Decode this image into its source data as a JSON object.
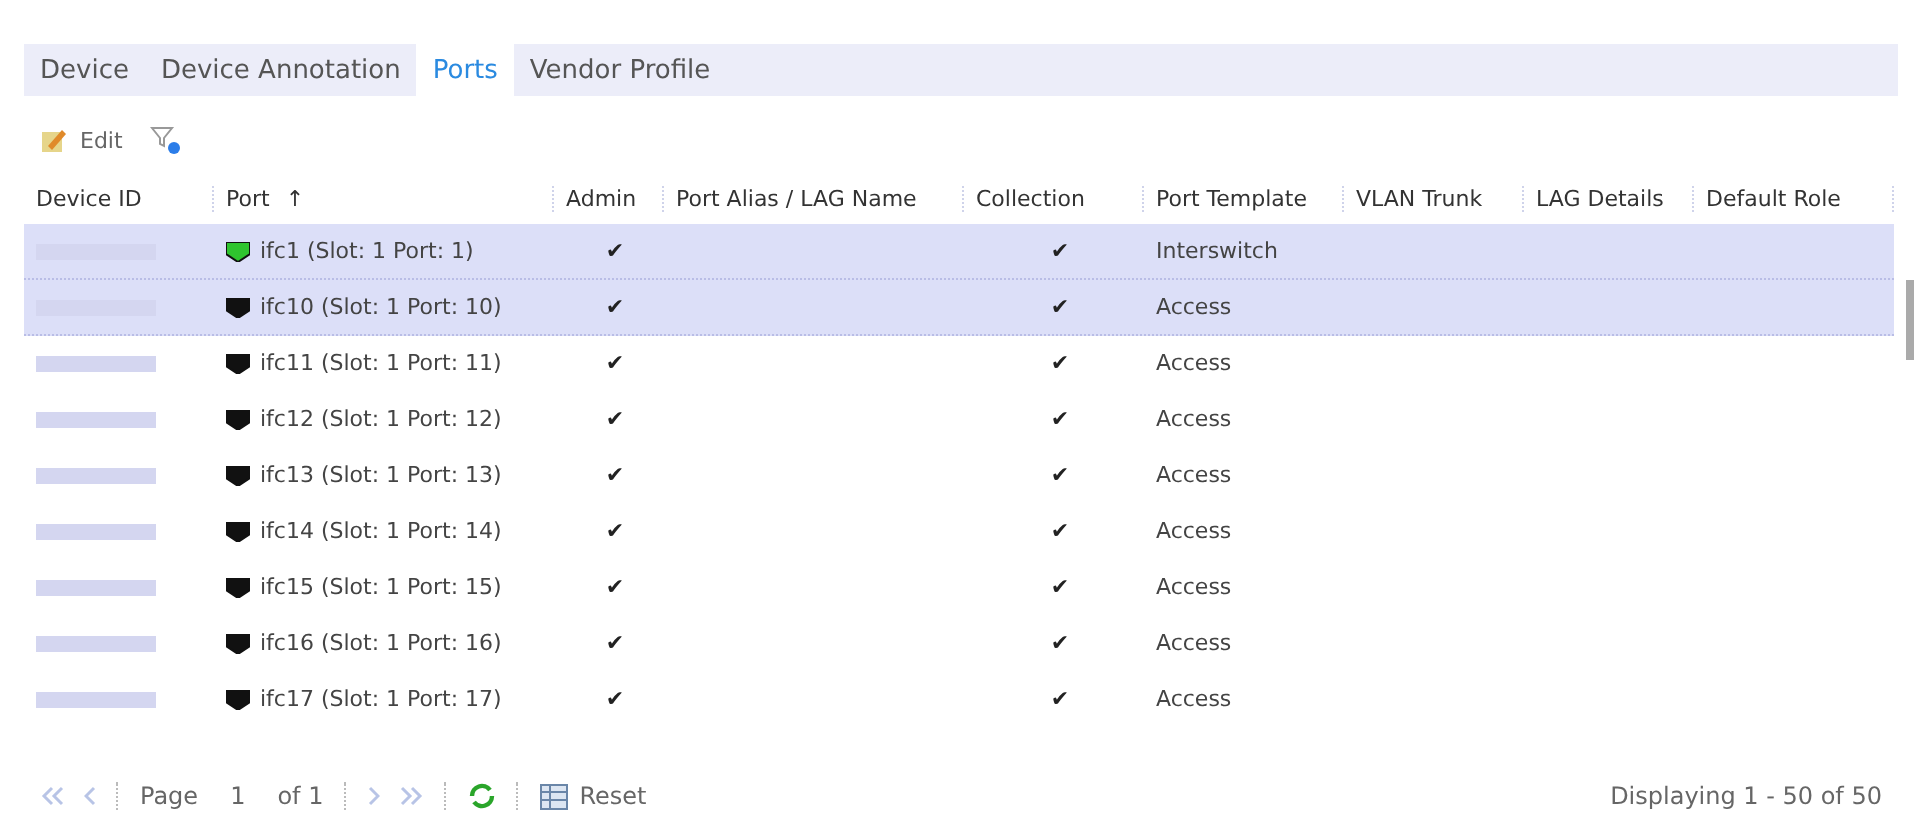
{
  "tabs": [
    {
      "label": "Device",
      "selected": false
    },
    {
      "label": "Device Annotation",
      "selected": false
    },
    {
      "label": "Ports",
      "selected": true
    },
    {
      "label": "Vendor Profile",
      "selected": false
    }
  ],
  "toolbar": {
    "edit_label": "Edit"
  },
  "table": {
    "columns": [
      "Device ID",
      "Port",
      "Admin",
      "Port Alias / LAG Name",
      "Collection",
      "Port Template",
      "VLAN Trunk",
      "LAG Details",
      "Default Role"
    ],
    "sort_mark": "↑",
    "rows": [
      {
        "selected": true,
        "port_up": true,
        "port": "ifc1 (Slot: 1 Port: 1)",
        "admin": "✔",
        "collection": "✔",
        "template": "Interswitch"
      },
      {
        "selected": true,
        "port_up": false,
        "port": "ifc10 (Slot: 1 Port: 10)",
        "admin": "✔",
        "collection": "✔",
        "template": "Access"
      },
      {
        "selected": false,
        "port_up": false,
        "port": "ifc11 (Slot: 1 Port: 11)",
        "admin": "✔",
        "collection": "✔",
        "template": "Access"
      },
      {
        "selected": false,
        "port_up": false,
        "port": "ifc12 (Slot: 1 Port: 12)",
        "admin": "✔",
        "collection": "✔",
        "template": "Access"
      },
      {
        "selected": false,
        "port_up": false,
        "port": "ifc13 (Slot: 1 Port: 13)",
        "admin": "✔",
        "collection": "✔",
        "template": "Access"
      },
      {
        "selected": false,
        "port_up": false,
        "port": "ifc14 (Slot: 1 Port: 14)",
        "admin": "✔",
        "collection": "✔",
        "template": "Access"
      },
      {
        "selected": false,
        "port_up": false,
        "port": "ifc15 (Slot: 1 Port: 15)",
        "admin": "✔",
        "collection": "✔",
        "template": "Access"
      },
      {
        "selected": false,
        "port_up": false,
        "port": "ifc16 (Slot: 1 Port: 16)",
        "admin": "✔",
        "collection": "✔",
        "template": "Access"
      },
      {
        "selected": false,
        "port_up": false,
        "port": "ifc17 (Slot: 1 Port: 17)",
        "admin": "✔",
        "collection": "✔",
        "template": "Access"
      }
    ]
  },
  "pager": {
    "page_label": "Page",
    "page": "1",
    "of": "of 1",
    "reset": "Reset",
    "display": "Displaying 1 - 50 of 50"
  }
}
